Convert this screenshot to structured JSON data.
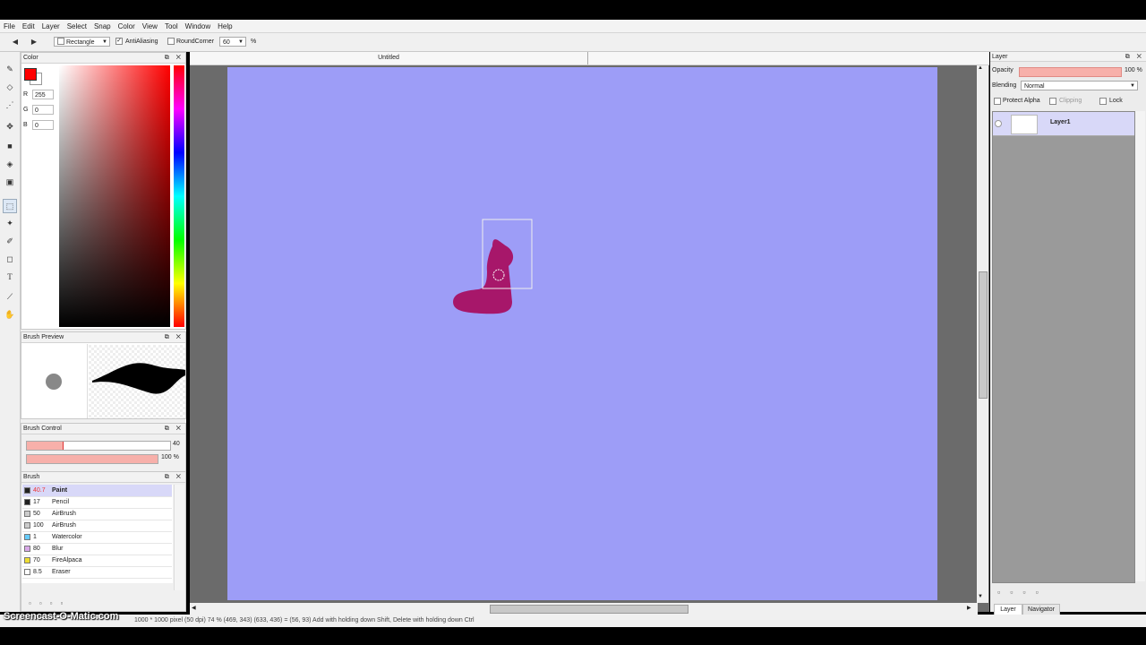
{
  "menu": [
    "File",
    "Edit",
    "Layer",
    "Select",
    "Snap",
    "Color",
    "View",
    "Tool",
    "Window",
    "Help"
  ],
  "toolbar": {
    "shape_value": "Rectangle",
    "antialias_label": "AntiAliasing",
    "antialias_check": "✓",
    "roundcorner_label": "RoundCorner",
    "roundcorner_value": "60",
    "percent": "%"
  },
  "document": {
    "tab_title": "Untitled",
    "canvas_color": "#9d9df7"
  },
  "color_panel": {
    "title": "Color",
    "r_label": "R",
    "r_value": "255",
    "g_label": "G",
    "g_value": "0",
    "b_label": "B",
    "b_value": "0",
    "fg_color": "#ff0000"
  },
  "brush_preview": {
    "title": "Brush Preview"
  },
  "brush_control": {
    "title": "Brush Control",
    "size_value": "40",
    "opacity_value": "100 %",
    "size_fraction": 0.25,
    "opacity_fraction": 1.0
  },
  "brush_panel": {
    "title": "Brush",
    "items": [
      {
        "size": "40.7",
        "name": "Paint",
        "color": "#222222"
      },
      {
        "size": "17",
        "name": "Pencil",
        "color": "#222222"
      },
      {
        "size": "50",
        "name": "AirBrush",
        "color": "#cccccc"
      },
      {
        "size": "100",
        "name": "AirBrush",
        "color": "#cccccc"
      },
      {
        "size": "1",
        "name": "Watercolor",
        "color": "#66ccff"
      },
      {
        "size": "80",
        "name": "Blur",
        "color": "#d8a8e8"
      },
      {
        "size": "70",
        "name": "FireAlpaca",
        "color": "#eedd33"
      },
      {
        "size": "8.5",
        "name": "Eraser",
        "color": "#ffffff"
      }
    ]
  },
  "layer_panel": {
    "title": "Layer",
    "opacity_label": "Opacity",
    "opacity_value": "100 %",
    "blending_label": "Blending",
    "blending_value": "Normal",
    "protect_alpha": "Protect Alpha",
    "clipping": "Clipping",
    "lock": "Lock",
    "layer_name": "Layer1",
    "tabs": [
      "Layer",
      "Navigator"
    ]
  },
  "status": {
    "text": "1000 * 1000 pixel  (50 dpi)  74 %  (469, 343)  (633, 436) = (56, 93)  Add with holding down Shift, Delete with holding down Ctrl",
    "watermark": "Screencast-O-Matic.com"
  }
}
